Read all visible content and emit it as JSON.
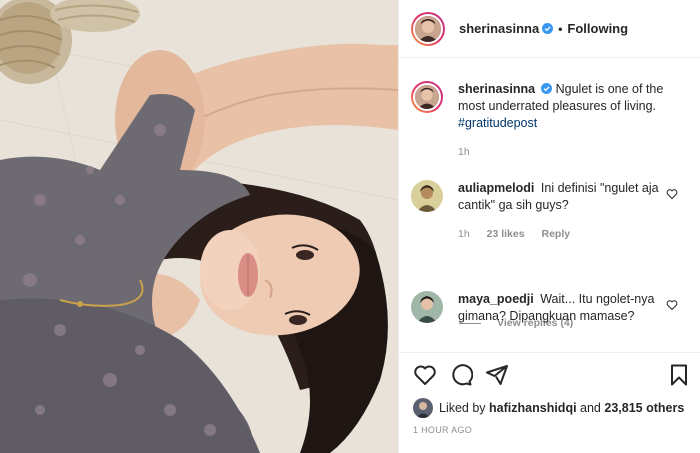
{
  "post": {
    "username": "sherinasinna",
    "separator": "•",
    "follow_state": "Following"
  },
  "caption": {
    "username": "sherinasinna",
    "text": "Ngulet is one of the most underrated pleasures of living.",
    "hashtag": "#gratitudepost",
    "time": "1h"
  },
  "comments": [
    {
      "username": "auliapmelodi",
      "text": "Ini definisi \"ngulet aja cantik\" ga sih guys?",
      "time": "1h",
      "likes": "23 likes",
      "reply": "Reply",
      "view_replies": "View replies (4)"
    },
    {
      "username": "maya_poedji",
      "text": "Wait... Itu ngolet-nya gimana? Dipangkuan mamase?"
    }
  ],
  "likes": {
    "prefix": "Liked by",
    "user": "hafizhanshidqi",
    "and": "and",
    "others": "23,815 others"
  },
  "timestamp": "1 HOUR AGO",
  "icons": [
    "verified-badge-icon",
    "heart-icon",
    "comment-icon",
    "share-icon",
    "bookmark-icon"
  ],
  "colors": {
    "text": "#262626",
    "muted": "#8e8e8e",
    "verified": "#3897f0",
    "hashtag": "#00376b",
    "border": "#efefef"
  }
}
